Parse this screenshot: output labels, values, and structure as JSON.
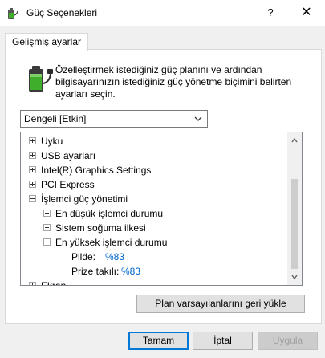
{
  "window": {
    "title": "Güç Seçenekleri",
    "help_label": "?",
    "close_label": "✕"
  },
  "tab": {
    "label": "Gelişmiş ayarlar"
  },
  "description": {
    "line1": "Özelleştirmek istediğiniz güç planını ve ardından",
    "line2": "bilgisayarınızın istediğiniz güç yönetme biçimini belirten",
    "line3": "ayarları seçin."
  },
  "plan_select": {
    "value": "Dengeli [Etkin]"
  },
  "tree": {
    "items": [
      {
        "label": "Uyku",
        "expanded": false
      },
      {
        "label": "USB ayarları",
        "expanded": false
      },
      {
        "label": "Intel(R) Graphics Settings",
        "expanded": false
      },
      {
        "label": "PCI Express",
        "expanded": false
      },
      {
        "label": "İşlemci güç yönetimi",
        "expanded": true
      },
      {
        "label": "En düşük işlemci durumu",
        "expanded": false
      },
      {
        "label": "Sistem soğuma ilkesi",
        "expanded": false
      },
      {
        "label": "En yüksek işlemci durumu",
        "expanded": true
      },
      {
        "label": "Ekran",
        "expanded": false
      }
    ],
    "settings": [
      {
        "label": "Pilde:",
        "value": "%83"
      },
      {
        "label": "Prize takılı:",
        "value": "%83"
      }
    ]
  },
  "buttons": {
    "restore_defaults": "Plan varsayılanlarını geri yükle",
    "ok": "Tamam",
    "cancel": "İptal",
    "apply": "Uygula"
  },
  "colors": {
    "accent": "#0078d7",
    "value_text": "#0066cc",
    "battery_green": "#3fae2a"
  },
  "icons": {
    "app": "battery-power-icon",
    "dialog": "battery-power-large-icon"
  }
}
